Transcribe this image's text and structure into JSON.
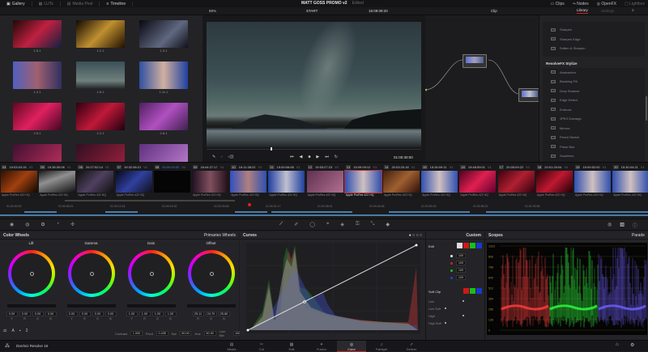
{
  "topbar": {
    "tabs": [
      {
        "label": "Gallery",
        "icon": "gallery-icon",
        "active": true
      },
      {
        "label": "LUTs",
        "icon": "luts-icon",
        "active": false
      },
      {
        "label": "Media Pool",
        "icon": "media-pool-icon",
        "active": false
      },
      {
        "label": "Timeline",
        "icon": "timeline-icon",
        "active": true
      }
    ],
    "project_title": "MATT GOSS PROMO v2",
    "project_status": "Edited",
    "right_tabs": [
      {
        "label": "Clips",
        "icon": "clips-icon"
      },
      {
        "label": "Nodes",
        "icon": "nodes-icon"
      },
      {
        "label": "OpenFX",
        "icon": "openfx-icon"
      },
      {
        "label": "Lightbox",
        "icon": "lightbox-icon"
      }
    ]
  },
  "toolbar": {
    "zoom": "89%",
    "timeline_name": "START",
    "timecode": "15:09:09:20",
    "node_mode": "Clip",
    "library_tab": "Library",
    "settings_tab": "Settings"
  },
  "gallery": {
    "stills": [
      "1.5.1",
      "1.2.1",
      "1.3.1",
      "1.4.1",
      "1.8.1",
      "1.11.1",
      "2.5.1",
      "2.2.1",
      "2.8.1",
      "",
      "",
      ""
    ]
  },
  "viewer": {
    "timecode": "01:00:30:00"
  },
  "library": {
    "top_items": [
      "Sharpen",
      "Sharpen Edge",
      "Soften & Sharpen"
    ],
    "section": "ResolveFX Stylize",
    "items": [
      "Abstraction",
      "Blanking Fill",
      "Drop Shadow",
      "Edge Detect",
      "Emboss",
      "JPEG Damage",
      "Mirrors",
      "Pencil Sketch",
      "Prism Blur",
      "Scanlines",
      "Stylize",
      "Tilt-Shift Blur"
    ]
  },
  "clips": [
    {
      "num": "04",
      "tc": "19:03:03:15",
      "track": "V1",
      "codec": "Apple ProRes 422 HQ"
    },
    {
      "num": "05",
      "tc": "19:35:30:08",
      "track": "V1",
      "codec": "Apple ProRes 422 HQ"
    },
    {
      "num": "06",
      "tc": "20:27:52:14",
      "track": "V1",
      "codec": "Apple ProRes 422 HQ"
    },
    {
      "num": "07",
      "tc": "19:32:38:21",
      "track": "V1",
      "codec": "Apple ProRes 422 HQ"
    },
    {
      "num": "08",
      "tc": "00:00:00:00",
      "track": "V1",
      "codec": ""
    },
    {
      "num": "09",
      "tc": "18:44:27:17",
      "track": "V1",
      "codec": "Apple ProRes 422 HQ"
    },
    {
      "num": "10",
      "tc": "16:11:38:22",
      "track": "V1",
      "codec": "Apple ProRes 422 HQ"
    },
    {
      "num": "11",
      "tc": "15:00:06:08",
      "track": "V1",
      "codec": "Apple ProRes 422 HQ"
    },
    {
      "num": "12",
      "tc": "19:53:27:23",
      "track": "V1",
      "codec": "Apple ProRes 422 HQ"
    },
    {
      "num": "13",
      "tc": "15:09:09:12",
      "track": "V1",
      "codec": "Apple ProRes 422 HQ"
    },
    {
      "num": "14",
      "tc": "20:03:20:18",
      "track": "V1",
      "codec": "Apple ProRes 422 HQ"
    },
    {
      "num": "15",
      "tc": "15:26:09:11",
      "track": "V1",
      "codec": "Apple ProRes 422 HQ"
    },
    {
      "num": "16",
      "tc": "19:48:59:01",
      "track": "V1",
      "codec": "Apple ProRes 422 HQ"
    },
    {
      "num": "17",
      "tc": "20:05:09:22",
      "track": "V1",
      "codec": "Apple ProRes 422 HQ"
    },
    {
      "num": "18",
      "tc": "20:01:29:04",
      "track": "V1",
      "codec": "Apple ProRes 422 HQ"
    },
    {
      "num": "19",
      "tc": "15:09:52:00",
      "track": "V1",
      "codec": "Apple ProRes 422 HQ"
    },
    {
      "num": "20",
      "tc": "15:30:04:21",
      "track": "V1",
      "codec": "Apple ProRes 422 HQ"
    }
  ],
  "mini_timeline": {
    "ticks": [
      "01:00:00:00",
      "01:00:06:01",
      "01:00:12:18",
      "01:00:19:02",
      "01:00:25:06",
      "01:00:31:17",
      "01:00:38:01",
      "01:00:44:06",
      "01:00:50:15",
      "01:00:56:22",
      "01:01:03:05"
    ]
  },
  "color_wheels": {
    "title": "Color Wheels",
    "mode": "Primaries Wheels",
    "wheels": [
      {
        "name": "Lift",
        "values": [
          "0.00",
          "0.00",
          "0.00",
          "0.00"
        ],
        "labels": [
          "Y",
          "R",
          "G",
          "B"
        ]
      },
      {
        "name": "Gamma",
        "values": [
          "0.00",
          "0.00",
          "0.00",
          "0.00"
        ],
        "labels": [
          "Y",
          "R",
          "G",
          "B"
        ]
      },
      {
        "name": "Gain",
        "values": [
          "1.00",
          "1.00",
          "1.00",
          "1.00"
        ],
        "labels": [
          "Y",
          "R",
          "G",
          "B"
        ]
      },
      {
        "name": "Offset",
        "values": [
          "25.11",
          "24.70",
          "25.80"
        ],
        "labels": [
          "R",
          "G",
          "B"
        ]
      }
    ],
    "adjust": [
      {
        "label": "Contrast",
        "value": "1.000"
      },
      {
        "label": "Pivot",
        "value": "0.435"
      },
      {
        "label": "Sat",
        "value": "50.00"
      },
      {
        "label": "Hue",
        "value": "50.00"
      },
      {
        "label": "Lum Mix",
        "value": "100.00"
      }
    ]
  },
  "curves": {
    "title": "Curves",
    "mode": "Custom"
  },
  "custom": {
    "edit_label": "Edit",
    "edit_values": [
      "100",
      "100",
      "100",
      "100"
    ],
    "softclip_label": "Soft Clip",
    "softclip_rows": [
      "Low",
      "Low Soft",
      "High",
      "High Soft"
    ]
  },
  "scopes": {
    "title": "Scopes",
    "mode": "Parade",
    "scale": [
      "1023",
      "896",
      "768",
      "640",
      "512",
      "384",
      "256",
      "128",
      "0"
    ]
  },
  "app_name": "DaVinci Resolve 16",
  "pages": [
    {
      "label": "Media",
      "icon": "media-icon"
    },
    {
      "label": "Cut",
      "icon": "cut-icon"
    },
    {
      "label": "Edit",
      "icon": "edit-icon"
    },
    {
      "label": "Fusion",
      "icon": "fusion-icon"
    },
    {
      "label": "Color",
      "icon": "color-icon",
      "active": true
    },
    {
      "label": "Fairlight",
      "icon": "fairlight-icon"
    },
    {
      "label": "Deliver",
      "icon": "deliver-icon"
    }
  ],
  "colors": {
    "accent": "#d02020",
    "panel": "#242428",
    "background": "#1e1e21"
  }
}
